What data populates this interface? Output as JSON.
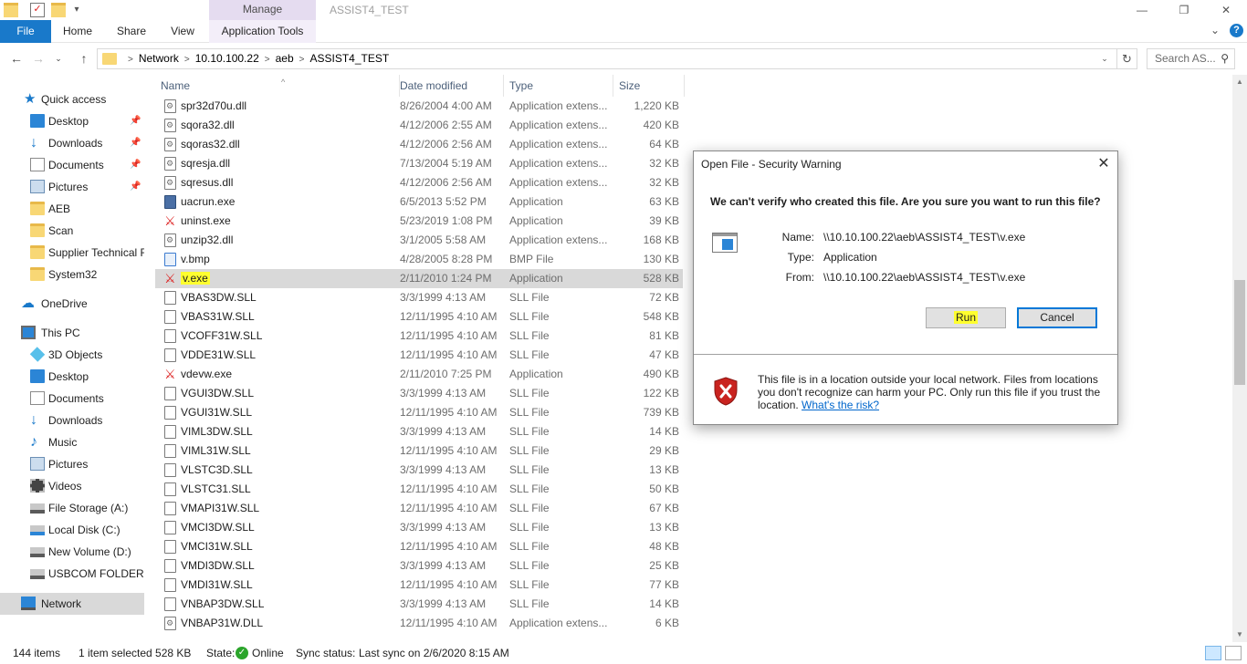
{
  "window": {
    "title": "ASSIST4_TEST",
    "contextual_tab_group": "Manage",
    "controls": {
      "minimize": "—",
      "restore": "❐",
      "close": "✕"
    }
  },
  "ribbon": {
    "tabs": [
      "File",
      "Home",
      "Share",
      "View",
      "Application Tools"
    ],
    "expand_glyph": "⌄",
    "help_glyph": "?"
  },
  "navigation": {
    "back": "←",
    "forward": "→",
    "recent": "⌄",
    "up": "↑",
    "breadcrumb": [
      "Network",
      "10.10.100.22",
      "aeb",
      "ASSIST4_TEST"
    ],
    "separator": ">",
    "dropdown": "⌄",
    "refresh": "↻",
    "search_placeholder": "Search AS...",
    "search_glyph": "⚲"
  },
  "sidebar": {
    "pin_glyph": "📌",
    "items": [
      {
        "label": "Quick access",
        "icon": "star-icon"
      },
      {
        "label": "Desktop",
        "icon": "desktop-icon",
        "pinned": true
      },
      {
        "label": "Downloads",
        "icon": "download-icon",
        "pinned": true
      },
      {
        "label": "Documents",
        "icon": "documents-icon",
        "pinned": true
      },
      {
        "label": "Pictures",
        "icon": "pictures-icon",
        "pinned": true
      },
      {
        "label": "AEB",
        "icon": "folder-icon"
      },
      {
        "label": "Scan",
        "icon": "folder-icon"
      },
      {
        "label": "Supplier Technical F",
        "icon": "folder-icon"
      },
      {
        "label": "System32",
        "icon": "folder-icon"
      },
      {
        "label": "OneDrive",
        "icon": "cloud-icon"
      },
      {
        "label": "This PC",
        "icon": "computer-icon"
      },
      {
        "label": "3D Objects",
        "icon": "cube-icon"
      },
      {
        "label": "Desktop",
        "icon": "desktop-icon"
      },
      {
        "label": "Documents",
        "icon": "documents-icon"
      },
      {
        "label": "Downloads",
        "icon": "download-icon"
      },
      {
        "label": "Music",
        "icon": "music-icon"
      },
      {
        "label": "Pictures",
        "icon": "pictures-icon"
      },
      {
        "label": "Videos",
        "icon": "video-icon"
      },
      {
        "label": "File Storage (A:)",
        "icon": "drive-icon"
      },
      {
        "label": "Local Disk (C:)",
        "icon": "drive-icon"
      },
      {
        "label": "New Volume (D:)",
        "icon": "drive-icon"
      },
      {
        "label": "USBCOM FOLDER (",
        "icon": "drive-icon"
      },
      {
        "label": "Network",
        "icon": "network-icon",
        "selected": true
      }
    ]
  },
  "file_list": {
    "sort_glyph": "^",
    "columns": [
      "Name",
      "Date modified",
      "Type",
      "Size"
    ],
    "rows": [
      {
        "name": "spr32d70u.dll",
        "date": "8/26/2004 4:00 AM",
        "type": "Application extens...",
        "size": "1,220 KB",
        "kind": "dll"
      },
      {
        "name": "sqora32.dll",
        "date": "4/12/2006 2:55 AM",
        "type": "Application extens...",
        "size": "420 KB",
        "kind": "dll"
      },
      {
        "name": "sqoras32.dll",
        "date": "4/12/2006 2:56 AM",
        "type": "Application extens...",
        "size": "64 KB",
        "kind": "dll"
      },
      {
        "name": "sqresja.dll",
        "date": "7/13/2004 5:19 AM",
        "type": "Application extens...",
        "size": "32 KB",
        "kind": "dll"
      },
      {
        "name": "sqresus.dll",
        "date": "4/12/2006 2:56 AM",
        "type": "Application extens...",
        "size": "32 KB",
        "kind": "dll"
      },
      {
        "name": "uacrun.exe",
        "date": "6/5/2013 5:52 PM",
        "type": "Application",
        "size": "63 KB",
        "kind": "app"
      },
      {
        "name": "uninst.exe",
        "date": "5/23/2019 1:08 PM",
        "type": "Application",
        "size": "39 KB",
        "kind": "vexe"
      },
      {
        "name": "unzip32.dll",
        "date": "3/1/2005 5:58 AM",
        "type": "Application extens...",
        "size": "168 KB",
        "kind": "dll"
      },
      {
        "name": "v.bmp",
        "date": "4/28/2005 8:28 PM",
        "type": "BMP File",
        "size": "130 KB",
        "kind": "bmp"
      },
      {
        "name": "v.exe",
        "date": "2/11/2010 1:24 PM",
        "type": "Application",
        "size": "528 KB",
        "kind": "vexe",
        "selected": true
      },
      {
        "name": "VBAS3DW.SLL",
        "date": "3/3/1999 4:13 AM",
        "type": "SLL File",
        "size": "72 KB",
        "kind": "sll"
      },
      {
        "name": "VBAS31W.SLL",
        "date": "12/11/1995 4:10 AM",
        "type": "SLL File",
        "size": "548 KB",
        "kind": "sll"
      },
      {
        "name": "VCOFF31W.SLL",
        "date": "12/11/1995 4:10 AM",
        "type": "SLL File",
        "size": "81 KB",
        "kind": "sll"
      },
      {
        "name": "VDDE31W.SLL",
        "date": "12/11/1995 4:10 AM",
        "type": "SLL File",
        "size": "47 KB",
        "kind": "sll"
      },
      {
        "name": "vdevw.exe",
        "date": "2/11/2010 7:25 PM",
        "type": "Application",
        "size": "490 KB",
        "kind": "vexe"
      },
      {
        "name": "VGUI3DW.SLL",
        "date": "3/3/1999 4:13 AM",
        "type": "SLL File",
        "size": "122 KB",
        "kind": "sll"
      },
      {
        "name": "VGUI31W.SLL",
        "date": "12/11/1995 4:10 AM",
        "type": "SLL File",
        "size": "739 KB",
        "kind": "sll"
      },
      {
        "name": "VIML3DW.SLL",
        "date": "3/3/1999 4:13 AM",
        "type": "SLL File",
        "size": "14 KB",
        "kind": "sll"
      },
      {
        "name": "VIML31W.SLL",
        "date": "12/11/1995 4:10 AM",
        "type": "SLL File",
        "size": "29 KB",
        "kind": "sll"
      },
      {
        "name": "VLSTC3D.SLL",
        "date": "3/3/1999 4:13 AM",
        "type": "SLL File",
        "size": "13 KB",
        "kind": "sll"
      },
      {
        "name": "VLSTC31.SLL",
        "date": "12/11/1995 4:10 AM",
        "type": "SLL File",
        "size": "50 KB",
        "kind": "sll"
      },
      {
        "name": "VMAPI31W.SLL",
        "date": "12/11/1995 4:10 AM",
        "type": "SLL File",
        "size": "67 KB",
        "kind": "sll"
      },
      {
        "name": "VMCI3DW.SLL",
        "date": "3/3/1999 4:13 AM",
        "type": "SLL File",
        "size": "13 KB",
        "kind": "sll"
      },
      {
        "name": "VMCI31W.SLL",
        "date": "12/11/1995 4:10 AM",
        "type": "SLL File",
        "size": "48 KB",
        "kind": "sll"
      },
      {
        "name": "VMDI3DW.SLL",
        "date": "3/3/1999 4:13 AM",
        "type": "SLL File",
        "size": "25 KB",
        "kind": "sll"
      },
      {
        "name": "VMDI31W.SLL",
        "date": "12/11/1995 4:10 AM",
        "type": "SLL File",
        "size": "77 KB",
        "kind": "sll"
      },
      {
        "name": "VNBAP3DW.SLL",
        "date": "3/3/1999 4:13 AM",
        "type": "SLL File",
        "size": "14 KB",
        "kind": "sll"
      },
      {
        "name": "VNBAP31W.DLL",
        "date": "12/11/1995 4:10 AM",
        "type": "Application extens...",
        "size": "6 KB",
        "kind": "dll"
      }
    ]
  },
  "scrollbar": {
    "up": "▲",
    "down": "▼"
  },
  "status_bar": {
    "item_count": "144 items",
    "selection": "1 item selected  528 KB",
    "state_label": "State:",
    "state_glyph": "✓",
    "state_value": "Online",
    "sync_label": "Sync status:",
    "sync_value": "Last sync on 2/6/2020 8:15 AM"
  },
  "dialog": {
    "title": "Open File - Security Warning",
    "close_glyph": "✕",
    "question": "We can't verify who created this file. Are you sure you want to run this file?",
    "name_label": "Name:",
    "name_value": "\\\\10.10.100.22\\aeb\\ASSIST4_TEST\\v.exe",
    "type_label": "Type:",
    "type_value": "Application",
    "from_label": "From:",
    "from_value": "\\\\10.10.100.22\\aeb\\ASSIST4_TEST\\v.exe",
    "run_label": "Run",
    "cancel_label": "Cancel",
    "warning_text": "This file is in a location outside your local network. Files from locations you don't recognize can harm your PC. Only run this file if you trust the location.",
    "warning_link": "What's the risk?",
    "highlight_color": "#ffff2f"
  },
  "colors": {
    "accent": "#1979ca",
    "selection": "#cde8ff",
    "selected_row": "#d9d9d9",
    "manage_tab": "#e5dcf0"
  }
}
